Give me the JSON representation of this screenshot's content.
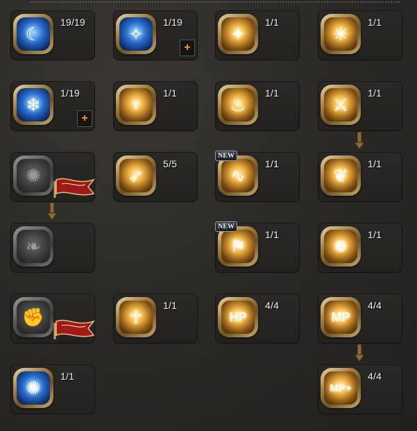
{
  "skills": [
    {
      "id": "s1",
      "count": "19/19",
      "glyph": "☾",
      "style": "blue"
    },
    {
      "id": "s2",
      "count": "1/19",
      "glyph": "✧",
      "style": "blue",
      "plus": "+"
    },
    {
      "id": "s3",
      "count": "1/1",
      "glyph": "✦",
      "style": "gold"
    },
    {
      "id": "s4",
      "count": "1/1",
      "glyph": "☀",
      "style": "gold"
    },
    {
      "id": "s5",
      "count": "1/19",
      "glyph": "❄",
      "style": "blue",
      "plus": "+"
    },
    {
      "id": "s6",
      "count": "1/1",
      "glyph": "♆",
      "style": "gold"
    },
    {
      "id": "s7",
      "count": "1/1",
      "glyph": "♨",
      "style": "gold"
    },
    {
      "id": "s8",
      "count": "1/1",
      "glyph": "⚔",
      "style": "gold"
    },
    {
      "id": "s9",
      "count": "",
      "glyph": "✺",
      "style": "grey"
    },
    {
      "id": "s10",
      "count": "5/5",
      "glyph": "➶",
      "style": "gold"
    },
    {
      "id": "s11",
      "count": "1/1",
      "glyph": "∿",
      "style": "gold",
      "new": "NEW"
    },
    {
      "id": "s12",
      "count": "1/1",
      "glyph": "❦",
      "style": "gold"
    },
    {
      "id": "s13",
      "count": "",
      "glyph": "❧",
      "style": "grey"
    },
    {
      "id": "s14",
      "count": "1/1",
      "glyph": "⚑",
      "style": "gold",
      "new": "NEW"
    },
    {
      "id": "s15",
      "count": "1/1",
      "glyph": "✹",
      "style": "gold"
    },
    {
      "id": "s16",
      "count": "",
      "glyph": "✊",
      "style": "grey"
    },
    {
      "id": "s17",
      "count": "1/1",
      "glyph": "☥",
      "style": "gold"
    },
    {
      "id": "s18",
      "count": "4/4",
      "glyph": "HP",
      "style": "gold"
    },
    {
      "id": "s19",
      "count": "4/4",
      "glyph": "MP",
      "style": "gold"
    },
    {
      "id": "s20",
      "count": "1/1",
      "glyph": "✺",
      "style": "blue"
    },
    {
      "id": "s21",
      "count": "4/4",
      "glyph": "MP+",
      "style": "gold"
    }
  ],
  "colors": {
    "background": "#2c2a27",
    "plus": "#ff9a1a",
    "count_text": "#f2f2f2",
    "arrow": "#8a6a38",
    "flag": "#a01818"
  }
}
